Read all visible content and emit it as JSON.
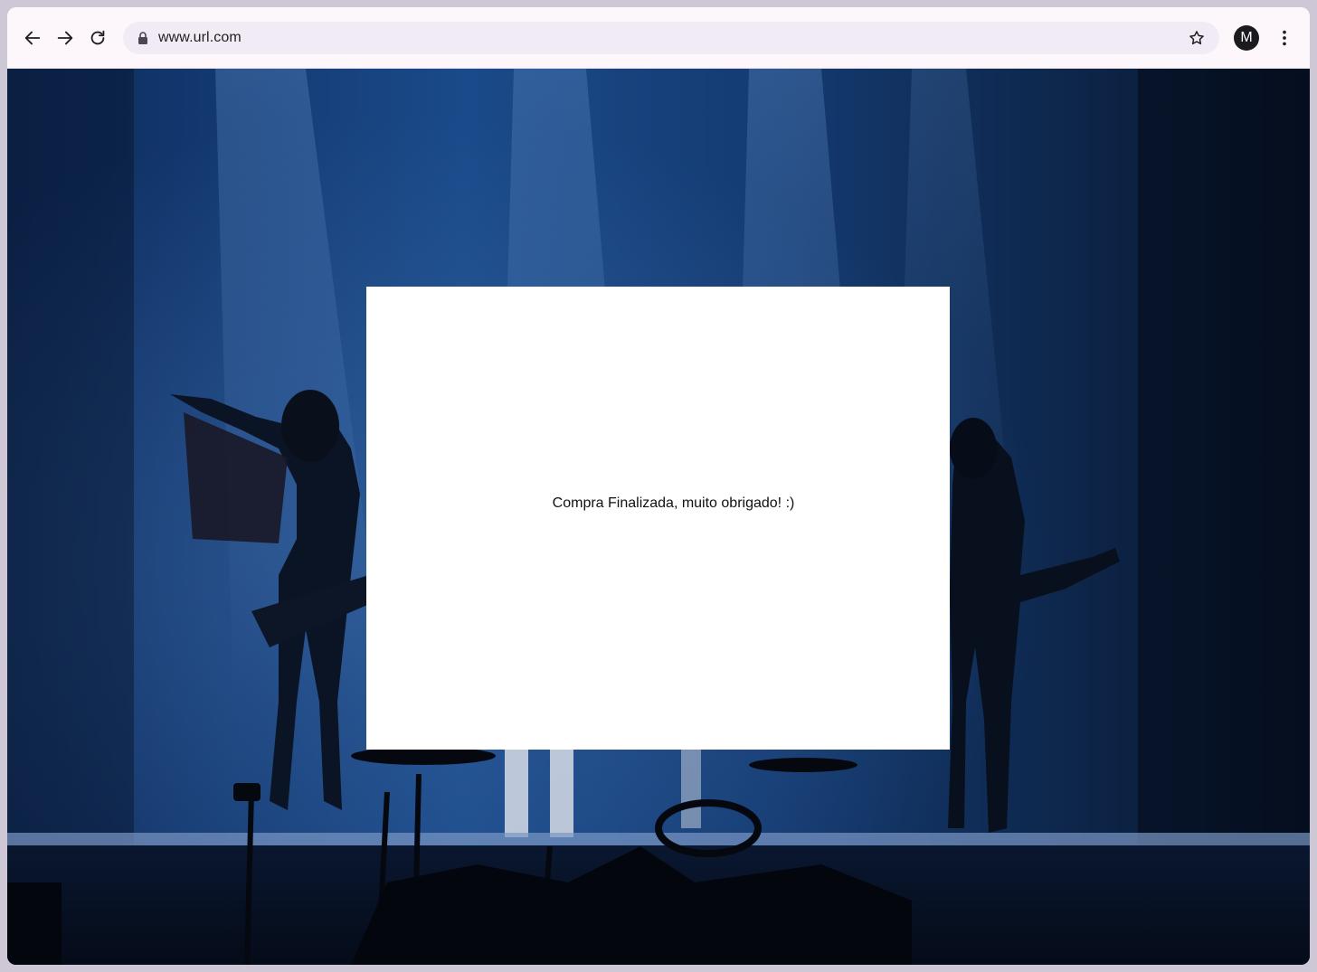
{
  "browser": {
    "url": "www.url.com",
    "profile_initial": "M",
    "icons": {
      "back": "arrow-left-icon",
      "forward": "arrow-right-icon",
      "reload": "reload-icon",
      "lock": "lock-icon",
      "bookmark": "star-icon",
      "menu": "more-vert-icon"
    }
  },
  "page": {
    "background_image": "concert-stage-photo",
    "dialog": {
      "message": "Compra Finalizada, muito obrigado! :)"
    }
  },
  "colors": {
    "toolbar": "#fdf7fc",
    "address_bar": "#f1ebf5",
    "avatar": "#1b1b1f",
    "dialog": "#ffffff",
    "stage_blue": "#1a4a8a"
  }
}
